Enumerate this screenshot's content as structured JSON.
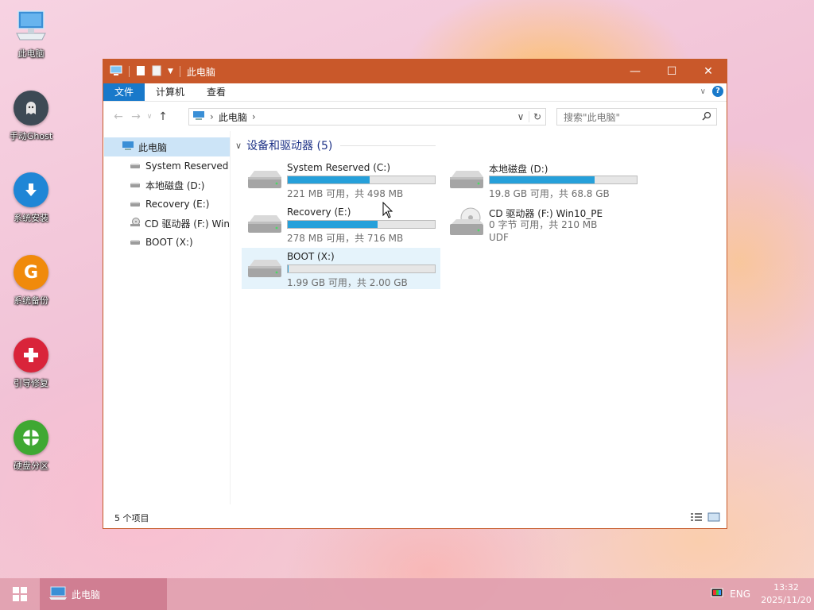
{
  "desktop": {
    "icons": [
      {
        "label": "此电脑",
        "icon": "this-pc-icon"
      },
      {
        "label": "手动Ghost",
        "icon": "ghost-icon",
        "color": "#3d4a55"
      },
      {
        "label": "系统安装",
        "icon": "download-arrow-icon",
        "color": "#1f86d6"
      },
      {
        "label": "系统备份",
        "icon": "g-backup-icon",
        "color": "#f08a0b"
      },
      {
        "label": "引导修复",
        "icon": "plus-repair-icon",
        "color": "#d9243a"
      },
      {
        "label": "硬盘分区",
        "icon": "partition-icon",
        "color": "#3fa832"
      }
    ]
  },
  "window": {
    "title": "此电脑",
    "accent": "#c9582a",
    "ribbon_tabs": [
      "文件",
      "计算机",
      "查看"
    ],
    "address": {
      "crumb": "此电脑"
    },
    "search": {
      "placeholder": "搜索\"此电脑\""
    },
    "nav_pane": [
      {
        "label": "此电脑",
        "icon": "this-pc-icon",
        "selected": true
      },
      {
        "label": "System Reserved",
        "icon": "drive-icon"
      },
      {
        "label": "本地磁盘 (D:)",
        "icon": "drive-icon"
      },
      {
        "label": "Recovery (E:)",
        "icon": "drive-icon"
      },
      {
        "label": "CD 驱动器 (F:) Win",
        "icon": "cd-drive-icon"
      },
      {
        "label": "BOOT (X:)",
        "icon": "drive-icon"
      }
    ],
    "group_header": "设备和驱动器 (5)",
    "drives": [
      {
        "name": "System Reserved (C:)",
        "info": "221 MB 可用，共 498 MB",
        "used_fraction": 0.556
      },
      {
        "name": "本地磁盘 (D:)",
        "info": "19.8 GB 可用，共 68.8 GB",
        "used_fraction": 0.712
      },
      {
        "name": "Recovery (E:)",
        "info": "278 MB 可用，共 716 MB",
        "used_fraction": 0.612
      },
      {
        "name": "CD 驱动器 (F:) Win10_PE",
        "info": "0 字节 可用，共 210 MB",
        "fs": "UDF"
      },
      {
        "name": "BOOT (X:)",
        "info": "1.99 GB 可用，共 2.00 GB",
        "used_fraction": 0.005,
        "selected": true
      }
    ],
    "status": {
      "count": "5 个项目"
    }
  },
  "taskbar": {
    "app_label": "此电脑",
    "lang": "ENG",
    "time": "13:32",
    "date": "2025/11/20"
  }
}
